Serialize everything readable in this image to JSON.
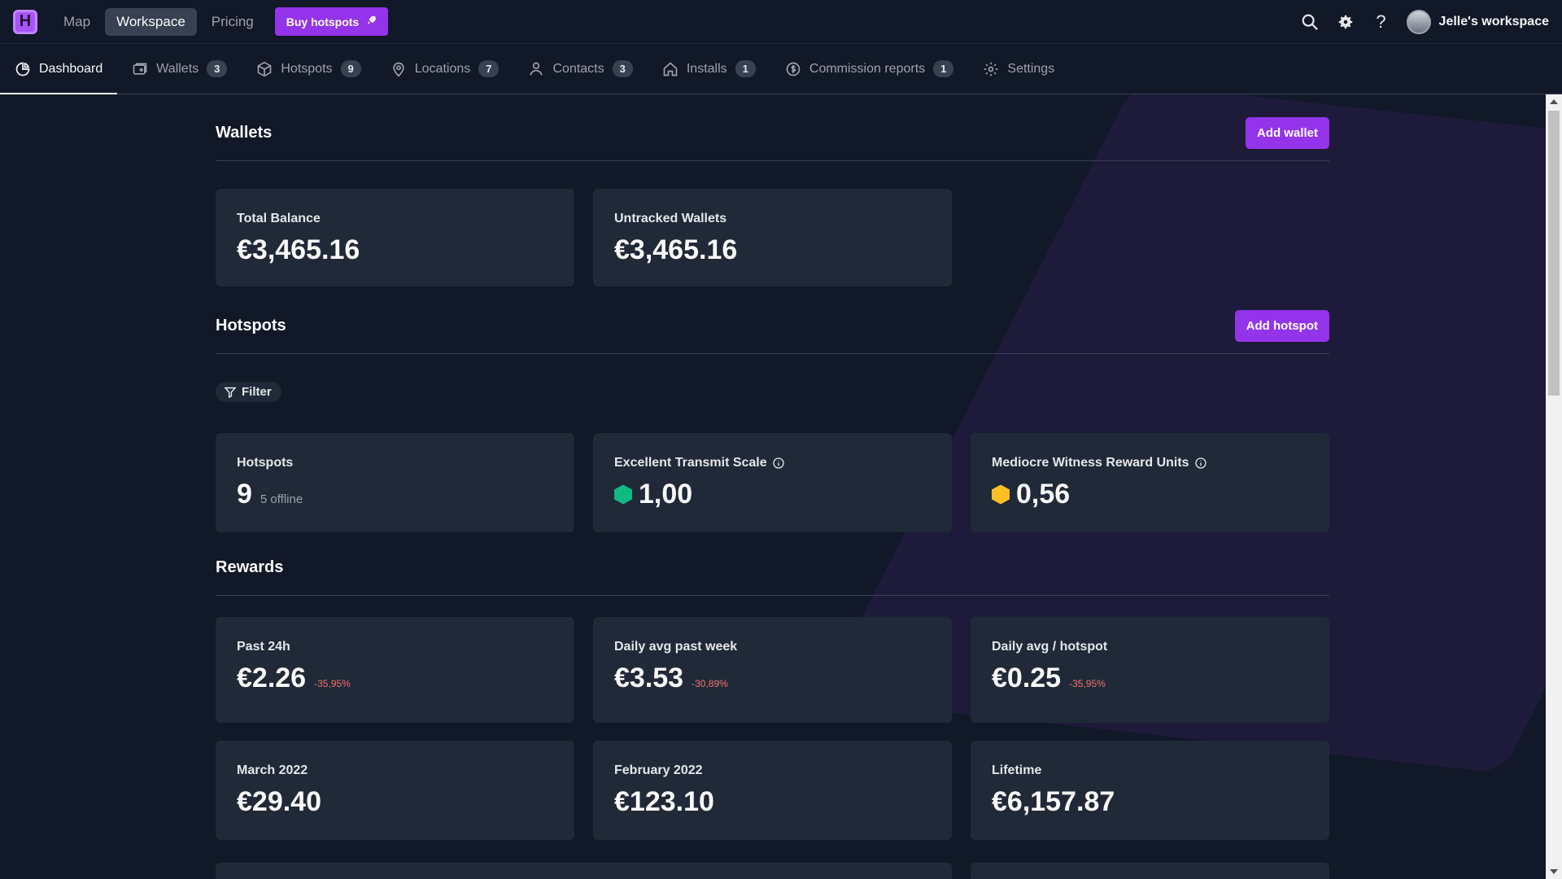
{
  "topbar": {
    "logo_letter": "H",
    "nav": [
      "Map",
      "Workspace",
      "Pricing"
    ],
    "active_nav": "Workspace",
    "buy_label": "Buy hotspots",
    "workspace_name": "Jelle's workspace"
  },
  "tabs": [
    {
      "label": "Dashboard",
      "icon": "pie-chart-icon",
      "badge": null,
      "active": true
    },
    {
      "label": "Wallets",
      "icon": "wallet-icon",
      "badge": "3"
    },
    {
      "label": "Hotspots",
      "icon": "cube-icon",
      "badge": "9"
    },
    {
      "label": "Locations",
      "icon": "map-pin-icon",
      "badge": "7"
    },
    {
      "label": "Contacts",
      "icon": "user-icon",
      "badge": "3"
    },
    {
      "label": "Installs",
      "icon": "home-icon",
      "badge": "1"
    },
    {
      "label": "Commission reports",
      "icon": "dollar-icon",
      "badge": "1"
    },
    {
      "label": "Settings",
      "icon": "gear-icon",
      "badge": null
    }
  ],
  "wallets": {
    "title": "Wallets",
    "add_label": "Add wallet",
    "cards": [
      {
        "label": "Total Balance",
        "value": "€3,465.16"
      },
      {
        "label": "Untracked Wallets",
        "value": "€3,465.16"
      }
    ]
  },
  "hotspots": {
    "title": "Hotspots",
    "add_label": "Add hotspot",
    "filter_label": "Filter",
    "cards": [
      {
        "label": "Hotspots",
        "value": "9",
        "sub": "5 offline"
      },
      {
        "label": "Excellent Transmit Scale",
        "value": "1,00",
        "hex_color": "#10b981"
      },
      {
        "label": "Mediocre Witness Reward Units",
        "value": "0,56",
        "hex_color": "#fbbf24"
      }
    ]
  },
  "rewards": {
    "title": "Rewards",
    "cards": [
      {
        "label": "Past 24h",
        "value": "€2.26",
        "delta": "-35,95%"
      },
      {
        "label": "Daily avg past week",
        "value": "€3.53",
        "delta": "-30,89%"
      },
      {
        "label": "Daily avg / hotspot",
        "value": "€0.25",
        "delta": "-35,95%"
      },
      {
        "label": "March 2022",
        "value": "€29.40"
      },
      {
        "label": "February 2022",
        "value": "€123.10"
      },
      {
        "label": "Lifetime",
        "value": "€6,157.87"
      }
    ]
  },
  "colors": {
    "accent": "#9333ea",
    "background": "#111827",
    "card": "#1f2937",
    "negative": "#f87171"
  }
}
